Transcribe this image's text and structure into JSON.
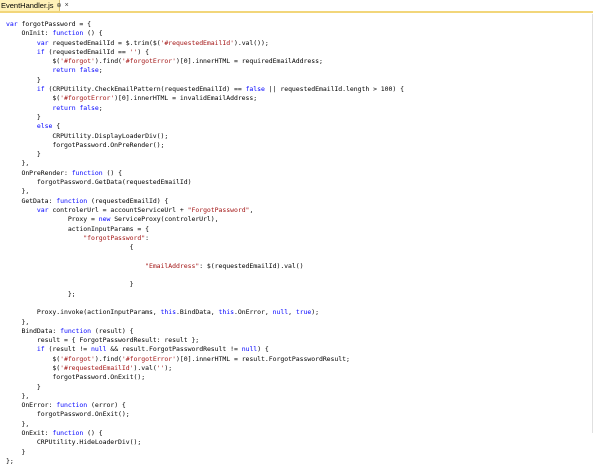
{
  "tab": {
    "filename": "EventHandler.js",
    "pin_glyph": "⊕",
    "close_glyph": "×"
  },
  "code_lines": [
    [
      [
        "kw",
        "var"
      ],
      [
        "txt",
        " forgotPassword = {"
      ]
    ],
    [
      [
        "txt",
        "    OnInit: "
      ],
      [
        "kw",
        "function"
      ],
      [
        "txt",
        " () {"
      ]
    ],
    [
      [
        "txt",
        "        "
      ],
      [
        "kw",
        "var"
      ],
      [
        "txt",
        " requestedEmailId = $.trim($("
      ],
      [
        "str",
        "'#requestedEmailId'"
      ],
      [
        "txt",
        ").val());"
      ]
    ],
    [
      [
        "txt",
        "        "
      ],
      [
        "kw",
        "if"
      ],
      [
        "txt",
        " (requestedEmailId == "
      ],
      [
        "str",
        "''"
      ],
      [
        "txt",
        ") {"
      ]
    ],
    [
      [
        "txt",
        "            $("
      ],
      [
        "str",
        "'#forgot'"
      ],
      [
        "txt",
        ").find("
      ],
      [
        "str",
        "'#forgotError'"
      ],
      [
        "txt",
        ")[0].innerHTML = requiredEmailAddress;"
      ]
    ],
    [
      [
        "txt",
        "            "
      ],
      [
        "kw",
        "return false"
      ],
      [
        "txt",
        ";"
      ]
    ],
    [
      [
        "txt",
        "        }"
      ]
    ],
    [
      [
        "txt",
        "        "
      ],
      [
        "kw",
        "if"
      ],
      [
        "txt",
        " (CRPUtility.CheckEmailPattern(requestedEmailId) == "
      ],
      [
        "kw",
        "false"
      ],
      [
        "txt",
        " || requestedEmailId.length > 100) {"
      ]
    ],
    [
      [
        "txt",
        "            $("
      ],
      [
        "str",
        "'#forgotError'"
      ],
      [
        "txt",
        ")[0].innerHTML = invalidEmailAddress;"
      ]
    ],
    [
      [
        "txt",
        "            "
      ],
      [
        "kw",
        "return false"
      ],
      [
        "txt",
        ";"
      ]
    ],
    [
      [
        "txt",
        "        }"
      ]
    ],
    [
      [
        "txt",
        "        "
      ],
      [
        "kw",
        "else"
      ],
      [
        "txt",
        " {"
      ]
    ],
    [
      [
        "txt",
        "            CRPUtility.DisplayLoaderDiv();"
      ]
    ],
    [
      [
        "txt",
        "            forgotPassword.OnPreRender();"
      ]
    ],
    [
      [
        "txt",
        "        }"
      ]
    ],
    [
      [
        "txt",
        "    },"
      ]
    ],
    [
      [
        "txt",
        "    OnPreRender: "
      ],
      [
        "kw",
        "function"
      ],
      [
        "txt",
        " () {"
      ]
    ],
    [
      [
        "txt",
        "        forgotPassword.GetData(requestedEmailId)"
      ]
    ],
    [
      [
        "txt",
        "    },"
      ]
    ],
    [
      [
        "txt",
        "    GetData: "
      ],
      [
        "kw",
        "function"
      ],
      [
        "txt",
        " (requestedEmailId) {"
      ]
    ],
    [
      [
        "txt",
        "        "
      ],
      [
        "kw",
        "var"
      ],
      [
        "txt",
        " controlerUrl = accountServiceUrl + "
      ],
      [
        "str",
        "\"ForgotPassword\""
      ],
      [
        "txt",
        ","
      ]
    ],
    [
      [
        "txt",
        "                Proxy = "
      ],
      [
        "kw",
        "new"
      ],
      [
        "txt",
        " ServiceProxy(controlerUrl),"
      ]
    ],
    [
      [
        "txt",
        "                actionInputParams = {"
      ]
    ],
    [
      [
        "txt",
        "                    "
      ],
      [
        "str",
        "\"forgotPassword\""
      ],
      [
        "txt",
        ":"
      ]
    ],
    [
      [
        "txt",
        "                                {"
      ]
    ],
    [
      [
        "txt",
        ""
      ]
    ],
    [
      [
        "txt",
        "                                    "
      ],
      [
        "str",
        "\"EmailAddress\""
      ],
      [
        "txt",
        ": $(requestedEmailId).val()"
      ]
    ],
    [
      [
        "txt",
        ""
      ]
    ],
    [
      [
        "txt",
        "                                }"
      ]
    ],
    [
      [
        "txt",
        "                };"
      ]
    ],
    [
      [
        "txt",
        ""
      ]
    ],
    [
      [
        "txt",
        "        Proxy.invoke(actionInputParams, "
      ],
      [
        "kw",
        "this"
      ],
      [
        "txt",
        ".BindData, "
      ],
      [
        "kw",
        "this"
      ],
      [
        "txt",
        ".OnError, "
      ],
      [
        "kw",
        "null"
      ],
      [
        "txt",
        ", "
      ],
      [
        "kw",
        "true"
      ],
      [
        "txt",
        ");"
      ]
    ],
    [
      [
        "txt",
        "    },"
      ]
    ],
    [
      [
        "txt",
        "    BindData: "
      ],
      [
        "kw",
        "function"
      ],
      [
        "txt",
        " (result) {"
      ]
    ],
    [
      [
        "txt",
        "        result = { ForgotPasswordResult: result };"
      ]
    ],
    [
      [
        "txt",
        "        "
      ],
      [
        "kw",
        "if"
      ],
      [
        "txt",
        " (result != "
      ],
      [
        "kw",
        "null"
      ],
      [
        "txt",
        " && result.ForgotPasswordResult != "
      ],
      [
        "kw",
        "null"
      ],
      [
        "txt",
        ") {"
      ]
    ],
    [
      [
        "txt",
        "            $("
      ],
      [
        "str",
        "'#forgot'"
      ],
      [
        "txt",
        ").find("
      ],
      [
        "str",
        "'#forgotError'"
      ],
      [
        "txt",
        ")[0].innerHTML = result.ForgotPasswordResult;"
      ]
    ],
    [
      [
        "txt",
        "            $("
      ],
      [
        "str",
        "'#requestedEmailId'"
      ],
      [
        "txt",
        ").val("
      ],
      [
        "str",
        "''"
      ],
      [
        "txt",
        ");"
      ]
    ],
    [
      [
        "txt",
        "            forgotPassword.OnExit();"
      ]
    ],
    [
      [
        "txt",
        "        }"
      ]
    ],
    [
      [
        "txt",
        "    },"
      ]
    ],
    [
      [
        "txt",
        "    OnError: "
      ],
      [
        "kw",
        "function"
      ],
      [
        "txt",
        " (error) {"
      ]
    ],
    [
      [
        "txt",
        "        forgotPassword.OnExit();"
      ]
    ],
    [
      [
        "txt",
        "    },"
      ]
    ],
    [
      [
        "txt",
        "    OnExit: "
      ],
      [
        "kw",
        "function"
      ],
      [
        "txt",
        " () {"
      ]
    ],
    [
      [
        "txt",
        "        CRPUtility.HideLoaderDiv();"
      ]
    ],
    [
      [
        "txt",
        "    }"
      ]
    ],
    [
      [
        "txt",
        "};"
      ]
    ]
  ],
  "colors": {
    "keyword": "#0000ff",
    "string": "#a31515",
    "text": "#000000",
    "tab_background": "#fff1b8"
  }
}
